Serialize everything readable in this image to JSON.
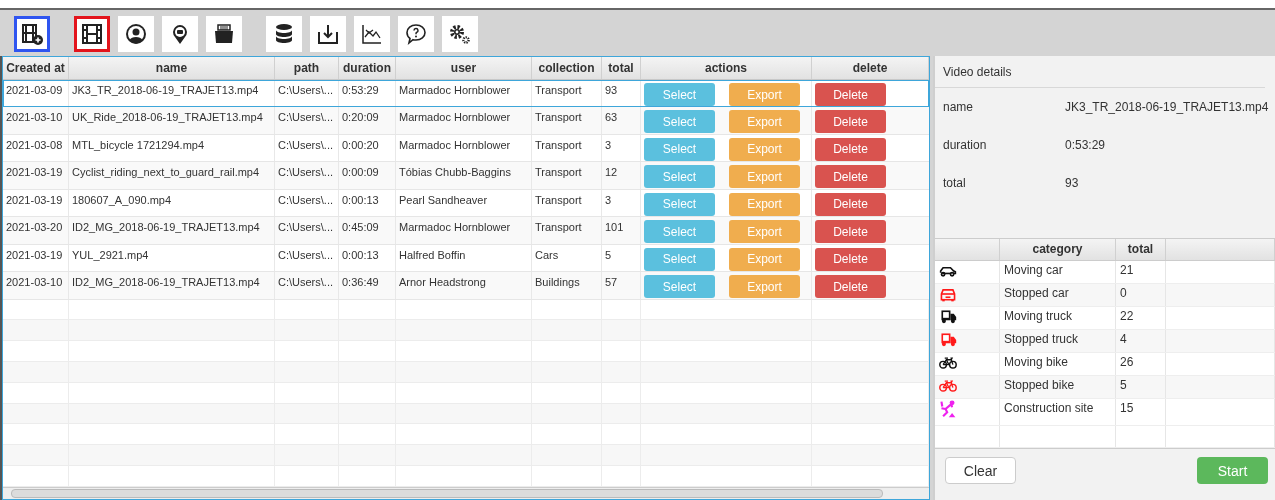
{
  "toolbar": {
    "groups": [
      [
        {
          "selected": true,
          "color": "#2f55f0"
        }
      ],
      [
        {
          "selected": true,
          "color": "#e3141c"
        },
        {
          "selected": false
        },
        {
          "selected": false
        },
        {
          "selected": false
        }
      ],
      [
        {
          "selected": false
        },
        {
          "selected": false
        },
        {
          "selected": false
        },
        {
          "selected": false
        },
        {
          "selected": false
        }
      ]
    ]
  },
  "videos": {
    "columns": [
      "Created at",
      "name",
      "path",
      "duration",
      "user",
      "collection",
      "total",
      "actions",
      "delete"
    ],
    "rows": [
      {
        "created_at": "2021-03-09",
        "name": "JK3_TR_2018-06-19_TRAJET13.mp4",
        "path": "C:\\Users\\...",
        "duration": "0:53:29",
        "user": "Marmadoc  Hornblower",
        "collection": "Transport",
        "total": "93",
        "actions": [
          "Select",
          "Export"
        ],
        "delete": "Delete",
        "selected": true
      },
      {
        "created_at": "2021-03-10",
        "name": "UK_Ride_2018-06-19_TRAJET13.mp4",
        "path": "C:\\Users\\...",
        "duration": "0:20:09",
        "user": "Marmadoc  Hornblower",
        "collection": "Transport",
        "total": "63",
        "actions": [
          "Select",
          "Export"
        ],
        "delete": "Delete",
        "selected": false
      },
      {
        "created_at": "2021-03-08",
        "name": "MTL_bicycle 1721294.mp4",
        "path": "C:\\Users\\...",
        "duration": "0:00:20",
        "user": "Marmadoc  Hornblower",
        "collection": "Transport",
        "total": "3",
        "actions": [
          "Select",
          "Export"
        ],
        "delete": "Delete",
        "selected": false
      },
      {
        "created_at": "2021-03-19",
        "name": "Cyclist_riding_next_to_guard_rail.mp4",
        "path": "C:\\Users\\...",
        "duration": "0:00:09",
        "user": "Tóbias  Chubb-Baggins",
        "collection": "Transport",
        "total": "12",
        "actions": [
          "Select",
          "Export"
        ],
        "delete": "Delete",
        "selected": false
      },
      {
        "created_at": "2021-03-19",
        "name": "180607_A_090.mp4",
        "path": "C:\\Users\\...",
        "duration": "0:00:13",
        "user": "Pearl  Sandheaver",
        "collection": "Transport",
        "total": "3",
        "actions": [
          "Select",
          "Export"
        ],
        "delete": "Delete",
        "selected": false
      },
      {
        "created_at": "2021-03-20",
        "name": "ID2_MG_2018-06-19_TRAJET13.mp4",
        "path": "C:\\Users\\...",
        "duration": "0:45:09",
        "user": "Marmadoc  Hornblower",
        "collection": "Transport",
        "total": "101",
        "actions": [
          "Select",
          "Export"
        ],
        "delete": "Delete",
        "selected": false
      },
      {
        "created_at": "2021-03-19",
        "name": "YUL_2921.mp4",
        "path": "C:\\Users\\...",
        "duration": "0:00:13",
        "user": "Halfred  Boffin",
        "collection": "Cars",
        "total": "5",
        "actions": [
          "Select",
          "Export"
        ],
        "delete": "Delete",
        "selected": false
      },
      {
        "created_at": "2021-03-10",
        "name": "ID2_MG_2018-06-19_TRAJET13.mp4",
        "path": "C:\\Users\\...",
        "duration": "0:36:49",
        "user": "Arnor  Headstrong",
        "collection": "Buildings",
        "total": "57",
        "actions": [
          "Select",
          "Export"
        ],
        "delete": "Delete",
        "selected": false
      }
    ]
  },
  "details": {
    "title": "Video details",
    "fields": [
      {
        "label": "name",
        "value": "JK3_TR_2018-06-19_TRAJET13.mp4"
      },
      {
        "label": "duration",
        "value": "0:53:29"
      },
      {
        "label": "total",
        "value": "93"
      }
    ]
  },
  "categories": {
    "columns": [
      "category",
      "total"
    ],
    "rows": [
      {
        "kind": "car",
        "color": "#111111",
        "category": "Moving car",
        "total": "21"
      },
      {
        "kind": "car-front",
        "color": "#ff1a1a",
        "category": "Stopped car",
        "total": "0"
      },
      {
        "kind": "truck",
        "color": "#111111",
        "category": "Moving truck",
        "total": "22"
      },
      {
        "kind": "truck",
        "color": "#ff1a1a",
        "category": "Stopped truck",
        "total": "4"
      },
      {
        "kind": "bike",
        "color": "#111111",
        "category": "Moving bike",
        "total": "26"
      },
      {
        "kind": "bike",
        "color": "#ff1a1a",
        "category": "Stopped bike",
        "total": "5"
      },
      {
        "kind": "construction",
        "color": "#ee22ee",
        "category": "Construction site",
        "total": "15"
      }
    ]
  },
  "buttons": [
    {
      "label": "Clear",
      "kind": "plain"
    },
    {
      "label": "Start",
      "kind": "primary"
    }
  ]
}
